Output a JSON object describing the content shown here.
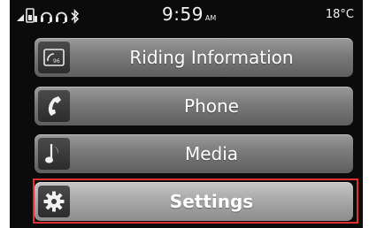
{
  "status_bar": {
    "icons": [
      "signal-icon",
      "phone-battery-icon",
      "headset-icon",
      "headset-icon",
      "bluetooth-icon"
    ],
    "time": "9:59",
    "ampm": "AM",
    "temperature": "18°C"
  },
  "menu": {
    "items": [
      {
        "label": "Riding Information",
        "icon": "speedometer-icon"
      },
      {
        "label": "Phone",
        "icon": "phone-icon"
      },
      {
        "label": "Media",
        "icon": "music-note-icon"
      },
      {
        "label": "Settings",
        "icon": "gear-icon"
      }
    ],
    "selected_label": "Settings"
  },
  "colors": {
    "screen_bg": "#0b0b0b",
    "button": "#7a7a7a",
    "selected_button": "#a9a9a9",
    "highlight": "#e03030"
  }
}
